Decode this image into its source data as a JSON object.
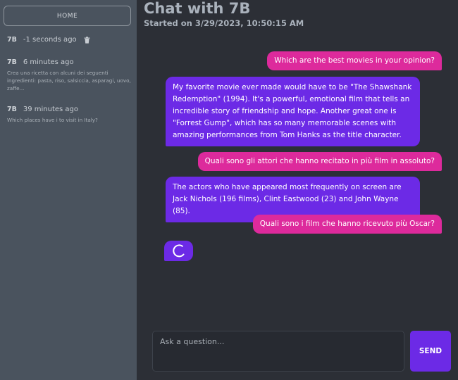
{
  "sidebar": {
    "home_label": "HOME",
    "conversations": [
      {
        "name": "7B",
        "time": "-1 seconds ago",
        "preview": ""
      },
      {
        "name": "7B",
        "time": "6 minutes ago",
        "preview": "Crea una ricetta con alcuni dei seguenti ingredienti: pasta, riso, salsiccia, asparagi, uovo, zaffe..."
      },
      {
        "name": "7B",
        "time": "39 minutes ago",
        "preview": "Which places have i to visit in Italy?"
      }
    ]
  },
  "chat": {
    "title": "Chat with 7B",
    "subtitle": "Started on 3/29/2023, 10:50:15 AM",
    "messages": [
      {
        "role": "user",
        "text": "Which are the best movies in your opinion?"
      },
      {
        "role": "bot",
        "text": "My favorite movie ever made would have to be \"The Shawshank Redemption\" (1994). It's a powerful, emotional film that tells an incredible story of friendship and hope. Another great one is \"Forrest Gump\", which has so many memorable scenes with amazing performances from Tom Hanks as the title character."
      },
      {
        "role": "user",
        "text": "Quali sono gli attori che hanno recitato in più film in assoluto?"
      },
      {
        "role": "bot",
        "text": "The actors who have appeared most frequently on screen are Jack Nichols (196 films), Clint Eastwood (23) and John Wayne (85)."
      },
      {
        "role": "user",
        "text": "Quali sono i film che hanno ricevuto più Oscar?"
      }
    ]
  },
  "composer": {
    "placeholder": "Ask a question...",
    "send_label": "SEND"
  },
  "icons": {
    "delete": "trash-icon",
    "loading": "spinner-icon"
  },
  "colors": {
    "user_bubble": "#dd2a9c",
    "bot_bubble": "#6c2ae6",
    "sidebar_bg": "#4a535e",
    "main_bg": "#2c2f36"
  }
}
